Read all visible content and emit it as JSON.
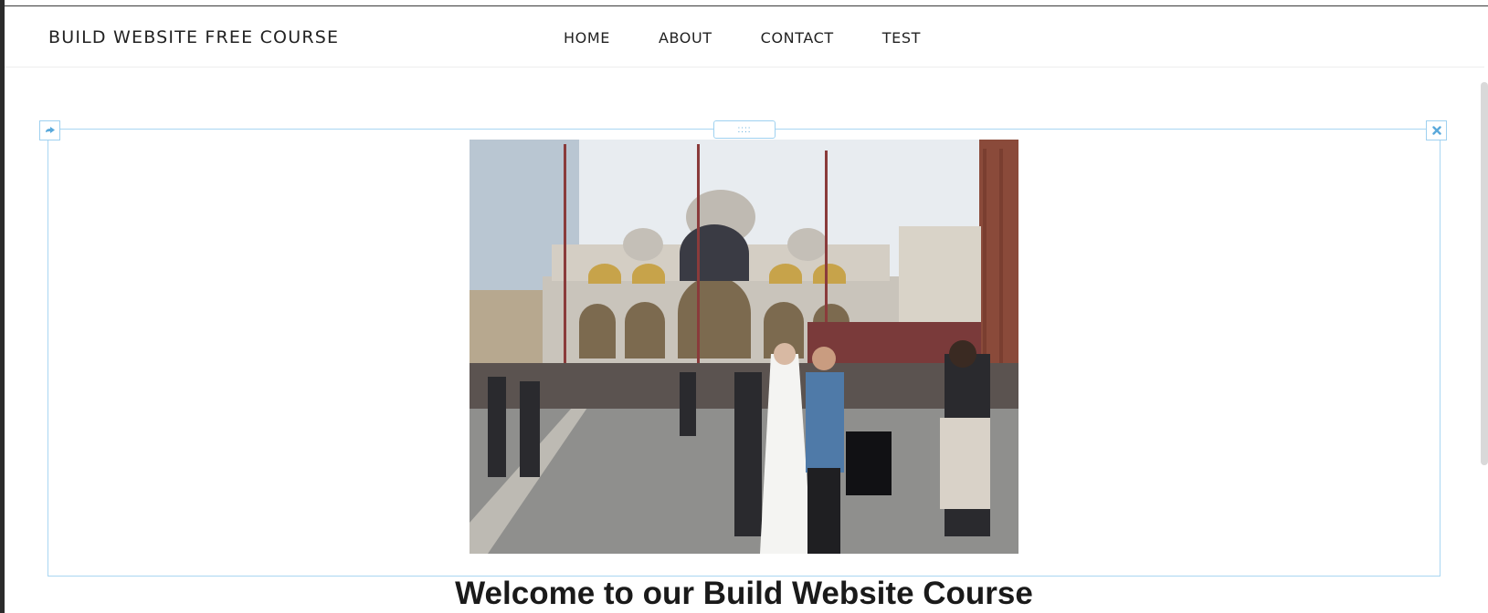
{
  "header": {
    "brand": "BUILD WEBSITE FREE COURSE",
    "nav": [
      "HOME",
      "ABOUT",
      "CONTACT",
      "TEST"
    ]
  },
  "editor": {
    "move_icon": "arrow-icon",
    "drag_handle": "::::",
    "close_icon": "close-icon"
  },
  "content": {
    "welcome_heading": "Welcome to our Build Website Course"
  },
  "colors": {
    "editor_border": "#a9d6f2",
    "text": "#222222"
  }
}
